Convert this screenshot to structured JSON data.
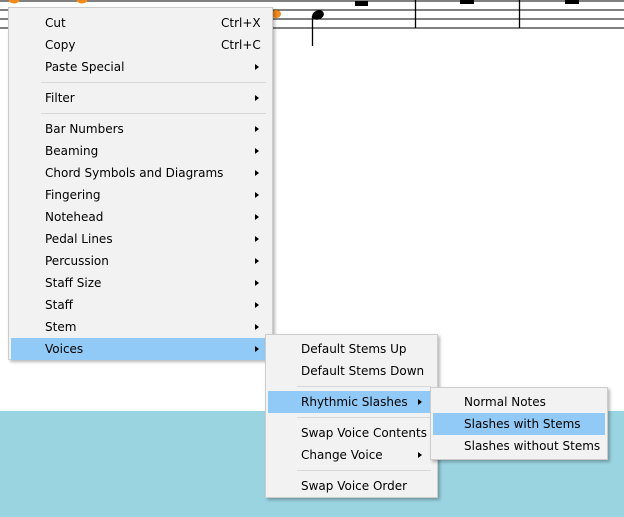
{
  "colors": {
    "menu_bg": "#f2f2f2",
    "highlight": "#91c9f7",
    "workspace_band": "#9bd4e1",
    "note_selected": "#f28a1c",
    "staff_line": "#000000"
  },
  "context_menu": {
    "items": [
      {
        "label": "Cut",
        "shortcut": "Ctrl+X"
      },
      {
        "label": "Copy",
        "shortcut": "Ctrl+C"
      },
      {
        "label": "Paste Special",
        "submenu": true
      },
      {
        "label": "Filter",
        "submenu": true
      },
      {
        "label": "Bar Numbers",
        "submenu": true
      },
      {
        "label": "Beaming",
        "submenu": true
      },
      {
        "label": "Chord Symbols and Diagrams",
        "submenu": true
      },
      {
        "label": "Fingering",
        "submenu": true
      },
      {
        "label": "Notehead",
        "submenu": true
      },
      {
        "label": "Pedal Lines",
        "submenu": true
      },
      {
        "label": "Percussion",
        "submenu": true
      },
      {
        "label": "Staff Size",
        "submenu": true
      },
      {
        "label": "Staff",
        "submenu": true
      },
      {
        "label": "Stem",
        "submenu": true
      },
      {
        "label": "Voices",
        "submenu": true,
        "highlighted": true
      }
    ]
  },
  "voices_submenu": {
    "items": [
      {
        "label": "Default Stems Up"
      },
      {
        "label": "Default Stems Down"
      },
      {
        "label": "Rhythmic Slashes",
        "submenu": true,
        "highlighted": true
      },
      {
        "label": "Swap Voice Contents"
      },
      {
        "label": "Change Voice",
        "submenu": true
      },
      {
        "label": "Swap Voice Order"
      }
    ]
  },
  "rhythmic_slashes_submenu": {
    "items": [
      {
        "label": "Normal Notes"
      },
      {
        "label": "Slashes with Stems",
        "highlighted": true
      },
      {
        "label": "Slashes without Stems"
      }
    ]
  }
}
